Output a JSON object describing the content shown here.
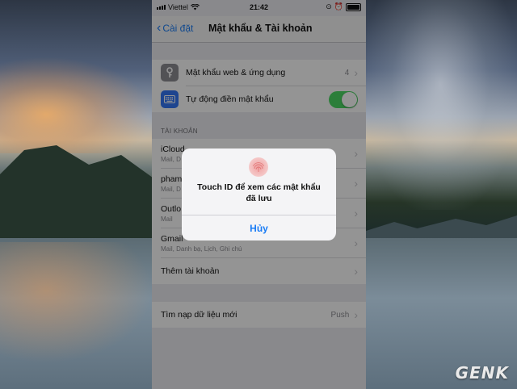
{
  "status_bar": {
    "carrier": "Viettel",
    "time": "21:42"
  },
  "nav": {
    "back_label": "Cài đặt",
    "title": "Mật khẩu & Tài khoản"
  },
  "settings": {
    "passwords_label": "Mật khẩu web & ứng dụng",
    "passwords_count": "4",
    "autofill_label": "Tự động điền mật khẩu",
    "autofill_on": true
  },
  "accounts": {
    "header": "TÀI KHOẢN",
    "items": [
      {
        "name": "iCloud",
        "sub": "Mail, D"
      },
      {
        "name": "pham",
        "sub": "Mail, D"
      },
      {
        "name": "Outlo",
        "sub": "Mail"
      },
      {
        "name": "Gmail",
        "sub": "Mail, Danh bạ, Lịch, Ghi chú"
      }
    ],
    "add_label": "Thêm tài khoản"
  },
  "fetch": {
    "label": "Tìm nạp dữ liệu mới",
    "value": "Push"
  },
  "alert": {
    "message": "Touch ID để xem các mật khẩu đã lưu",
    "cancel_label": "Hủy"
  },
  "watermark": "GENK",
  "colors": {
    "accent": "#1a7cf5",
    "toggle_on": "#4cd964",
    "key_icon_bg": "#8e8e93",
    "keyboard_icon_bg": "#3478f6"
  }
}
